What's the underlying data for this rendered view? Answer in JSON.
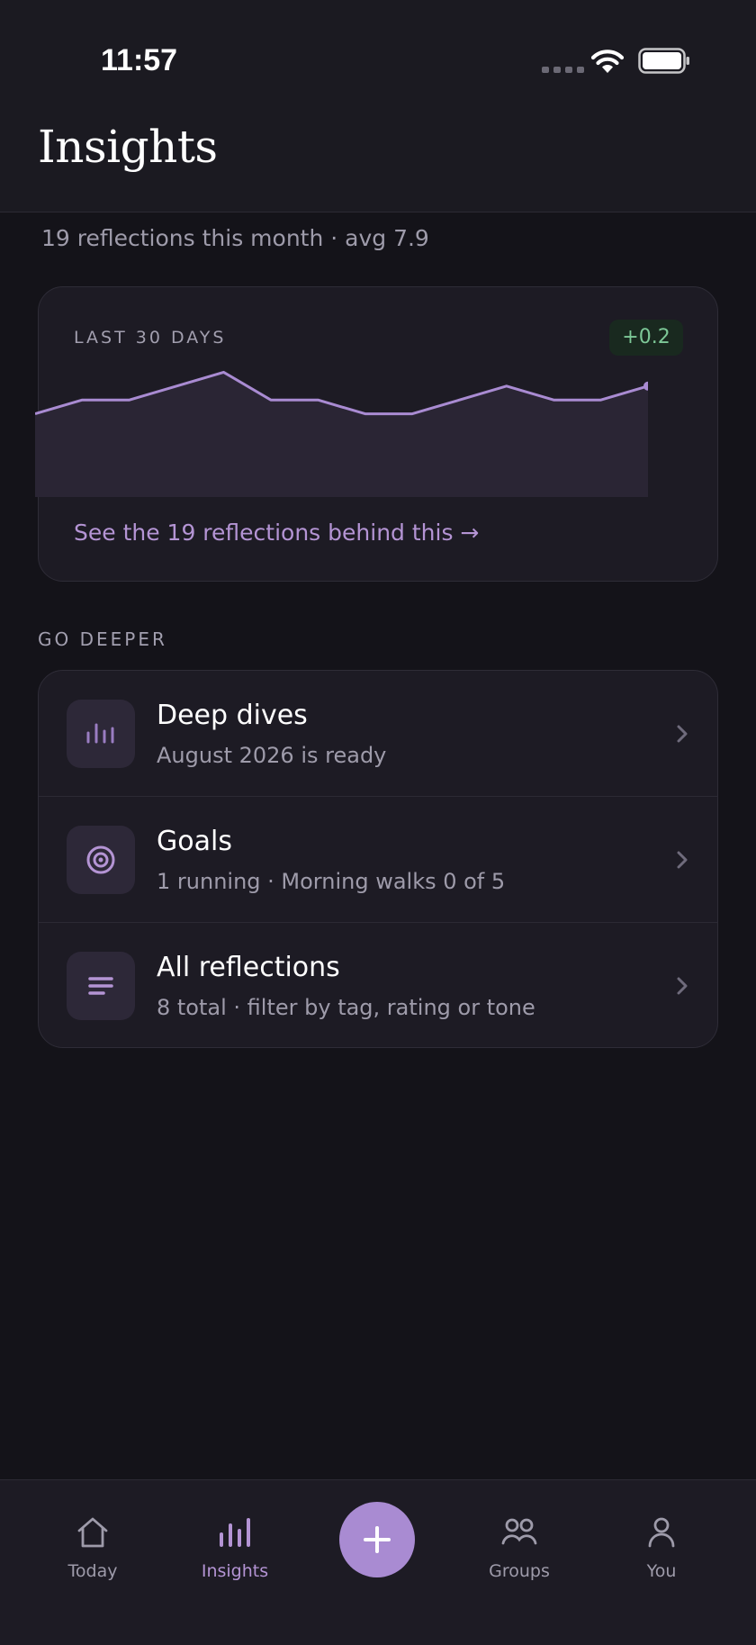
{
  "status_bar": {
    "time": "11:57"
  },
  "header": {
    "title": "Insights"
  },
  "summary": "19 reflections this month · avg 7.9",
  "chart_card": {
    "label": "LAST 30 DAYS",
    "delta": "+0.2",
    "link": "See the 19 reflections behind this →"
  },
  "chart_data": {
    "type": "area",
    "x": [
      1,
      2,
      3,
      4,
      5,
      6,
      7,
      8,
      9,
      10,
      11,
      12,
      13,
      14
    ],
    "values": [
      7.7,
      7.9,
      7.9,
      8.1,
      8.3,
      7.9,
      7.9,
      7.7,
      7.7,
      7.9,
      8.1,
      7.9,
      7.9,
      8.1
    ],
    "ylim": [
      6.5,
      8.5
    ],
    "title": "",
    "xlabel": "",
    "ylabel": "",
    "grid": false,
    "line_color": "#a98bd2",
    "fill_color": "#2a2534"
  },
  "section": {
    "label": "GO DEEPER"
  },
  "list": [
    {
      "title": "Deep dives",
      "subtitle": "August 2026 is ready",
      "icon": "bar-chart-icon"
    },
    {
      "title": "Goals",
      "subtitle": "1 running · Morning walks 0 of 5",
      "icon": "target-icon"
    },
    {
      "title": "All reflections",
      "subtitle": "8 total · filter by tag, rating or tone",
      "icon": "list-lines-icon"
    }
  ],
  "nav": {
    "items": [
      {
        "label": "Today",
        "icon": "home-icon"
      },
      {
        "label": "Insights",
        "icon": "bar-chart-icon",
        "active": true
      },
      {
        "label": "Groups",
        "icon": "people-icon"
      },
      {
        "label": "You",
        "icon": "person-icon"
      }
    ],
    "add_icon": "plus-icon"
  },
  "colors": {
    "background": "#141319",
    "card": "#1d1b24",
    "accent": "#a98bd2",
    "positive": "#7dc897"
  }
}
